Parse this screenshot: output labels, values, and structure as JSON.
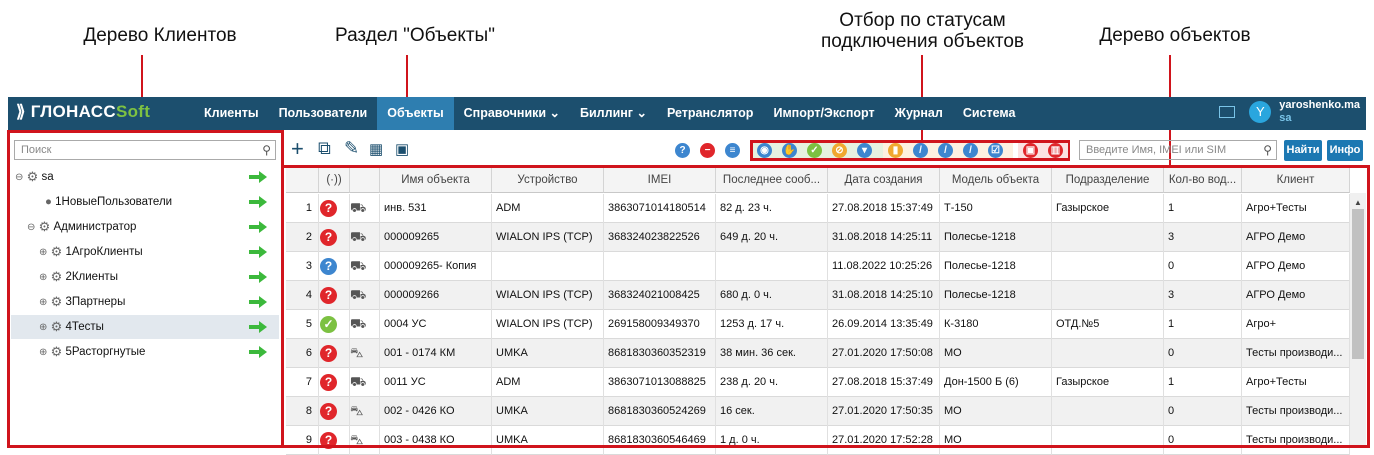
{
  "annotations": {
    "tree_clients": "Дерево Клиентов",
    "section_objects": "Раздел \"Объекты\"",
    "status_filter_1": "Отбор по статусам",
    "status_filter_2": "подключения объектов",
    "tree_objects": "Дерево объектов"
  },
  "brand": {
    "main": "ГЛОНАСС",
    "soft": "Soft"
  },
  "nav": [
    "Клиенты",
    "Пользователи",
    "Объекты",
    "Справочники ⌄",
    "Биллинг ⌄",
    "Ретранслятор",
    "Импорт/Экспорт",
    "Журнал",
    "Система"
  ],
  "user": {
    "avatar": "Y",
    "name": "yaroshenko.ma",
    "sub": "sa"
  },
  "left": {
    "search_placeholder": "Поиск",
    "tree": [
      {
        "label": "sa"
      },
      {
        "label": "1НовыеПользователи"
      },
      {
        "label": "Администратор"
      },
      {
        "label": "1АгроКлиенты"
      },
      {
        "label": "2Клиенты"
      },
      {
        "label": "3Партнеры"
      },
      {
        "label": "4Тесты"
      },
      {
        "label": "5Расторгнутые"
      }
    ]
  },
  "toolbar": {
    "search_placeholder": "Введите Имя, IMEI или SIM",
    "find_button": "Найти",
    "info_button": "Инфо"
  },
  "table": {
    "headers": [
      "",
      "(·))",
      "",
      "Имя объекта",
      "Устройство",
      "IMEI",
      "Последнее сооб...",
      "Дата создания",
      "Модель объекта",
      "Подразделение",
      "Кол-во вод...",
      "Клиент"
    ],
    "rows": [
      [
        "1",
        "inv 531",
        "инв. 531",
        "ADM",
        "3863071014180514",
        "82 д. 23 ч.",
        "27.08.2018 15:37:49",
        "Т-150",
        "Газырское",
        "1",
        "Агро+Тесты"
      ],
      [
        "2",
        "",
        "000009265",
        "WIALON IPS (TCP)",
        "368324023822526",
        "649 д. 20 ч.",
        "31.08.2018 14:25:11",
        "Полесье-1218",
        "",
        "3",
        "АГРО Демо"
      ],
      [
        "3",
        "",
        "000009265- Копия",
        "",
        "",
        "",
        "11.08.2022 10:25:26",
        "Полесье-1218",
        "",
        "0",
        "АГРО Демо"
      ],
      [
        "4",
        "",
        "000009266",
        "WIALON IPS (TCP)",
        "368324021008425",
        "680 д. 0 ч.",
        "31.08.2018 14:25:10",
        "Полесье-1218",
        "",
        "3",
        "АГРО Демо"
      ],
      [
        "5",
        "",
        "0004 УС",
        "WIALON IPS (TCP)",
        "269158009349370",
        "1253 д. 17 ч.",
        "26.09.2014 13:35:49",
        "К-3180",
        "ОТД.№5",
        "1",
        "Агро+"
      ],
      [
        "6",
        "",
        "001 - 0174 КМ",
        "UMKA",
        "8681830360352319",
        "38 мин. 36 сек.",
        "27.01.2020 17:50:08",
        "МО",
        "",
        "0",
        "Тесты производи..."
      ],
      [
        "7",
        "",
        "0011 УС",
        "ADM",
        "3863071013088825",
        "238 д. 20 ч.",
        "27.08.2018 15:37:49",
        "Дон-1500 Б (6)",
        "Газырское",
        "1",
        "Агро+Тесты"
      ],
      [
        "8",
        "",
        "002 - 0426 КО",
        "UMKA",
        "8681830360524269",
        "16 сек.",
        "27.01.2020 17:50:35",
        "МО",
        "",
        "0",
        "Тесты производи..."
      ],
      [
        "9",
        "",
        "003 - 0438 КО",
        "UMKA",
        "8681830360546469",
        "1 д. 0 ч.",
        "27.01.2020 17:52:28",
        "МО",
        "",
        "0",
        "Тесты производи..."
      ]
    ],
    "status": [
      "unknown",
      "unknown",
      "help",
      "unknown",
      "ok",
      "unknown",
      "unknown",
      "unknown",
      "unknown"
    ],
    "vehicle": [
      "tractor",
      "truck",
      "truck",
      "truck",
      "tractor",
      "car",
      "truck",
      "car",
      "car"
    ]
  },
  "colors": {
    "nav_bg": "#1c4f6e",
    "nav_active": "#2e7eb0",
    "annotation_red": "#d0141c",
    "status_red": "#e0262b",
    "status_green": "#7cc142",
    "status_blue": "#3d86cf"
  }
}
